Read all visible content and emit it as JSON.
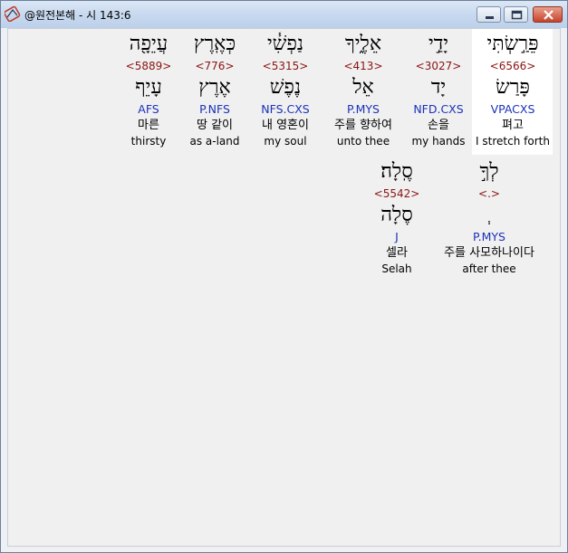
{
  "window": {
    "title": "@원전본해 - 시 143:6"
  },
  "row1": [
    {
      "hebrew": "פֵּרַ֣שְׂתִּי",
      "strong": "<6566>",
      "root": "פָּרַשׂ",
      "morph": "VPACXS",
      "korean": "펴고",
      "english": "I stretch forth",
      "highlight": true
    },
    {
      "hebrew": "יָדַ֣י",
      "strong": "<3027>",
      "root": "יָד",
      "morph": "NFD.CXS",
      "korean": "손을",
      "english": "my hands"
    },
    {
      "hebrew": "אֵלֶ֑יךָ",
      "strong": "<413>",
      "root": "אֵל",
      "morph": "P.MYS",
      "korean": "주를 향하여",
      "english": "unto thee"
    },
    {
      "hebrew": "נַפְשִׁ֓י",
      "strong": "<5315>",
      "root": "נֶפֶשׁ",
      "morph": "NFS.CXS",
      "korean": "내 영혼이",
      "english": "my soul"
    },
    {
      "hebrew": "כְּאֶֽרֶץ",
      "strong": "<776>",
      "root": "אֶרֶץ",
      "morph": "P.NFS",
      "korean": "땅 같이",
      "english": "as a-land"
    },
    {
      "hebrew": "עֲיֵפָ֖ה",
      "strong": "<5889>",
      "root": "עָיֵף",
      "morph": "AFS",
      "korean": "마른",
      "english": "thirsty"
    }
  ],
  "row2": [
    {
      "hebrew": "לְךָ֣",
      "strong": "<.>",
      "root": "ְ",
      "morph": "P.MYS",
      "korean": "주를 사모하나이다",
      "english": "after thee"
    },
    {
      "hebrew": "סֶֽלָה׃",
      "strong": "<5542>",
      "root": "סֶלָה",
      "morph": "J",
      "korean": "셀라",
      "english": "Selah"
    }
  ],
  "colors": {
    "strong": "#8b1414",
    "morph": "#1b32b8",
    "highlight": "#ffffff"
  }
}
